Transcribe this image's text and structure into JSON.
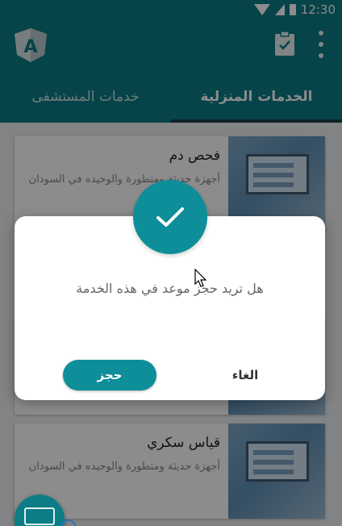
{
  "status_bar": {
    "time": "12:30"
  },
  "app_bar": {
    "logo_letter": "A"
  },
  "tabs": [
    {
      "label": "الخدمات المنزلية",
      "active": true
    },
    {
      "label": "خدمات المستشفى",
      "active": false
    }
  ],
  "services": [
    {
      "title": "فحص دم",
      "description": "أجهزة حديثة ومتطورة والوحيده في السودان"
    },
    {
      "title": "",
      "description": ""
    },
    {
      "title": "قياس سكري",
      "description": "أجهزة حديثة ومتطورة والوحيده في السودان"
    }
  ],
  "dialog": {
    "message": "هل تريد حجز موعد في هذه الخدمة",
    "confirm_label": "حجز",
    "cancel_label": "الغاء"
  },
  "colors": {
    "primary": "#0b7d86",
    "accent": "#0d8e99",
    "tab_indicator": "#1b3f45"
  }
}
